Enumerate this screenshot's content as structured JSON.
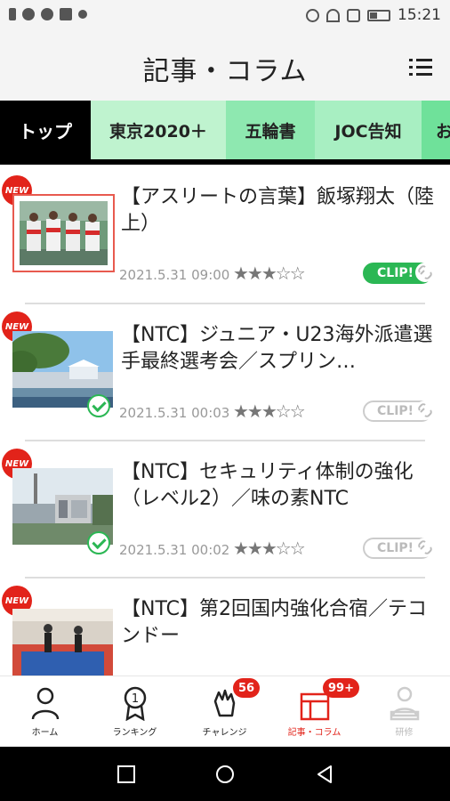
{
  "status_bar": {
    "time": "15:21",
    "left_icons": [
      "sim-icon",
      "cloud-icon",
      "twitter-icon",
      "image-icon",
      "app-icon"
    ],
    "right_icons": [
      "bluetooth-icon",
      "wifi-icon",
      "nfc-icon",
      "battery-icon"
    ]
  },
  "header": {
    "title": "記事・コラム",
    "menu_icon": "menu-icon"
  },
  "tabs": [
    {
      "label": "トップ",
      "active": true
    },
    {
      "label": "東京2020＋",
      "active": false
    },
    {
      "label": "五輪書",
      "active": false
    },
    {
      "label": "JOC告知",
      "active": false
    },
    {
      "label": "お",
      "active": false
    }
  ],
  "articles": [
    {
      "new_label": "NEW",
      "title": "【アスリートの言葉】飯塚翔太（陸上）",
      "date": "2021.5.31 09:00",
      "stars": "★★★☆☆",
      "rating": 3,
      "clip_label": "CLIP!",
      "clipped": true,
      "read": false
    },
    {
      "new_label": "NEW",
      "title": "【NTC】ジュニア・U23海外派遣選手最終選考会／スプリン…",
      "date": "2021.5.31 00:03",
      "stars": "★★★☆☆",
      "rating": 3,
      "clip_label": "CLIP!",
      "clipped": false,
      "read": true
    },
    {
      "new_label": "NEW",
      "title": "【NTC】セキュリティ体制の強化（レベル2）／味の素NTC",
      "date": "2021.5.31 00:02",
      "stars": "★★★☆☆",
      "rating": 3,
      "clip_label": "CLIP!",
      "clipped": false,
      "read": true
    },
    {
      "new_label": "NEW",
      "title": "【NTC】第2回国内強化合宿／テコンドー",
      "date": "",
      "stars": "",
      "rating": 0,
      "clip_label": "",
      "clipped": false,
      "read": false
    }
  ],
  "bottom_nav": [
    {
      "label": "ホーム",
      "icon": "person-icon",
      "badge": ""
    },
    {
      "label": "ランキング",
      "icon": "medal-icon",
      "badge": ""
    },
    {
      "label": "チャレンジ",
      "icon": "fist-icon",
      "badge": "56"
    },
    {
      "label": "記事・コラム",
      "icon": "article-icon",
      "badge": "99+"
    },
    {
      "label": "研修",
      "icon": "training-icon",
      "badge": ""
    }
  ],
  "colors": {
    "accent_red": "#e2231a",
    "clip_green": "#2bb754",
    "tab_green": "#8ee8b0"
  }
}
